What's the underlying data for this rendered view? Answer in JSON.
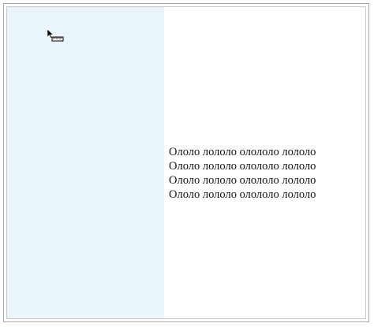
{
  "panels": {
    "left_color": "#e9f4fb",
    "right_color": "#ffffff"
  },
  "cursor": {
    "icon": "pointer-with-ruler-icon"
  },
  "content": {
    "lines": [
      "Ололо лололо олололо лололо",
      "Ололо лололо олололо лололо",
      "Ололо лололо олололо лололо",
      "Ололо лололо олололо лололо"
    ]
  }
}
